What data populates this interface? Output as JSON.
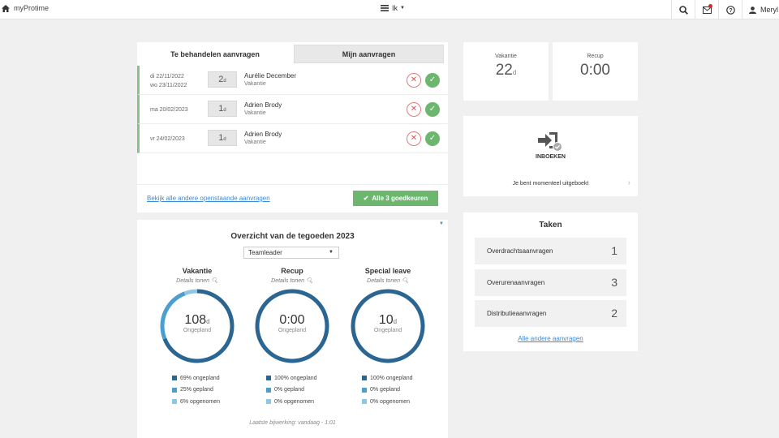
{
  "topbar": {
    "brand": "myProtime",
    "menu_label": "Ik",
    "user_name": "Meryl",
    "icons": [
      "home-icon",
      "hamburger-icon",
      "search-icon",
      "mail-icon",
      "help-icon",
      "user-icon"
    ]
  },
  "requests": {
    "tabs": [
      {
        "label": "Te behandelen aanvragen",
        "active": true
      },
      {
        "label": "Mijn aanvragen",
        "active": false
      }
    ],
    "rows": [
      {
        "date1": "di 22/11/2022",
        "date2": "wo 23/11/2022",
        "days": "2",
        "unit": "d",
        "name": "Aurélie December",
        "type": "Vakantie"
      },
      {
        "date1": "ma 20/02/2023",
        "date2": "",
        "days": "1",
        "unit": "d",
        "name": "Adrien Brody",
        "type": "Vakantie"
      },
      {
        "date1": "vr 24/02/2023",
        "date2": "",
        "days": "1",
        "unit": "d",
        "name": "Adrien Brody",
        "type": "Vakantie"
      }
    ],
    "view_all_link": "Bekijk alle andere openstaande aanvragen",
    "approve_all_label": "Alle 3 goedkeuren",
    "accent_color": "#6cb66e"
  },
  "overview": {
    "title": "Overzicht van de tegoeden 2023",
    "filter": "Teamleader",
    "details_label": "Details tonen",
    "balances": [
      {
        "name": "Vakantie",
        "value": "108",
        "unit": "d",
        "sub": "Ongepland",
        "legend": [
          "69% ongepland",
          "25% gepland",
          "6% opgenomen"
        ],
        "fractions": [
          0.69,
          0.25,
          0.06
        ]
      },
      {
        "name": "Recup",
        "value": "0:00",
        "unit": "",
        "sub": "Ongepland",
        "legend": [
          "100% ongepland",
          "0% gepland",
          "0% opgenomen"
        ],
        "fractions": [
          1,
          0,
          0
        ]
      },
      {
        "name": "Special leave",
        "value": "10",
        "unit": "d",
        "sub": "Ongepland",
        "legend": [
          "100% ongepland",
          "0% gepland",
          "0% opgenomen"
        ],
        "fractions": [
          1,
          0,
          0
        ]
      }
    ],
    "colors": {
      "ongepland": "#2b6592",
      "gepland": "#4b9fd0",
      "opgenomen": "#8cc8e3"
    },
    "updated": "Laatste bijwerking: vandaag - 1:01"
  },
  "stats": [
    {
      "label": "Vakantie",
      "value": "22",
      "unit": "d"
    },
    {
      "label": "Recup",
      "value": "0:00",
      "unit": ""
    }
  ],
  "inboeken": {
    "label": "INBOEKEN",
    "status": "Je bent momenteel uitgeboekt",
    "icon": "clock-in-icon"
  },
  "taken": {
    "title": "Taken",
    "items": [
      {
        "label": "Overdrachtsaanvragen",
        "count": "1"
      },
      {
        "label": "Overurenaanvragen",
        "count": "3"
      },
      {
        "label": "Distributieaanvragen",
        "count": "2"
      }
    ],
    "link": "Alle andere aanvragen"
  }
}
